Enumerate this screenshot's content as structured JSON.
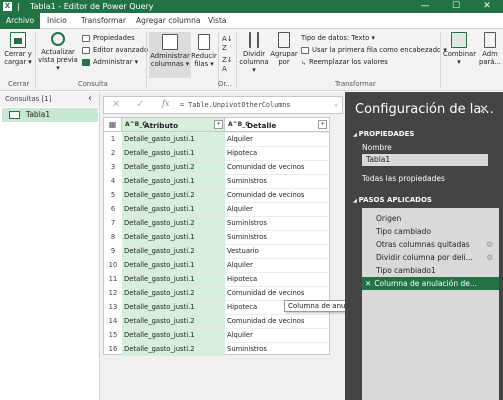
{
  "window": {
    "title": "Tabla1 - Editor de Power Query",
    "app_icon": "X",
    "controls": [
      "—",
      "☐",
      "✕"
    ]
  },
  "ribbon_tabs": [
    "Archivo",
    "Inicio",
    "Transformar",
    "Agregar columna",
    "Vista"
  ],
  "ribbon": {
    "cerrar": {
      "label": "Cerrar y cargar",
      "line1": "Cerrar y",
      "line2": "cargar ▾",
      "group": "Cerrar"
    },
    "consulta": {
      "actualizar_line1": "Actualizar",
      "actualizar_line2": "vista previa ▾",
      "propiedades": "Propiedades",
      "editor_avanzado": "Editor avanzado",
      "administrar": "Administrar ▾",
      "group": "Consulta"
    },
    "admin_cols": {
      "line1": "Administrar",
      "line2": "columnas ▾"
    },
    "reducir": {
      "line1": "Reducir",
      "line2": "filas ▾"
    },
    "ordenar_group": "Or...",
    "dividir": {
      "line1": "Dividir",
      "line2": "columna ▾"
    },
    "agrupar": {
      "line1": "Agrupar",
      "line2": "por"
    },
    "transformar": {
      "tipo_datos": "Tipo de datos: Texto ▾",
      "primera_fila": "Usar la primera fila como encabezado ▾",
      "reemplazar": "Reemplazar los valores",
      "group": "Transformar"
    },
    "combinar": "Combinar",
    "adm_param": {
      "line1": "Adm",
      "line2": "pará..."
    }
  },
  "queries": {
    "header": "Consultas [1]",
    "collapse": "‹",
    "items": [
      {
        "label": "Tabla1"
      }
    ]
  },
  "formula_bar": {
    "cancel": "✕",
    "commit": "✓",
    "fx": "fx",
    "text": "= Table.UnpivotOtherColumns",
    "expand": "⌄"
  },
  "grid": {
    "corner": "▦",
    "type_icon": "A^B_C",
    "columns": [
      {
        "name": "Atributo"
      },
      {
        "name": "Detalle"
      }
    ],
    "rows": [
      {
        "n": "1",
        "a": "Detalle_gasto_justi.1",
        "b": "Alquiler"
      },
      {
        "n": "2",
        "a": "Detalle_gasto_justi.1",
        "b": "Hipoteca"
      },
      {
        "n": "3",
        "a": "Detalle_gasto_justi.2",
        "b": "Comunidad de vecinos"
      },
      {
        "n": "4",
        "a": "Detalle_gasto_justi.1",
        "b": "Suministros"
      },
      {
        "n": "5",
        "a": "Detalle_gasto_justi.2",
        "b": "Comunidad de vecinos"
      },
      {
        "n": "6",
        "a": "Detalle_gasto_justi.1",
        "b": "Alquiler"
      },
      {
        "n": "7",
        "a": "Detalle_gasto_justi.2",
        "b": "Suministros"
      },
      {
        "n": "8",
        "a": "Detalle_gasto_justi.1",
        "b": "Suministros"
      },
      {
        "n": "9",
        "a": "Detalle_gasto_justi.2",
        "b": "Vestuario"
      },
      {
        "n": "10",
        "a": "Detalle_gasto_justi.1",
        "b": "Alquiler"
      },
      {
        "n": "11",
        "a": "Detalle_gasto_justi.1",
        "b": "Hipoteca"
      },
      {
        "n": "12",
        "a": "Detalle_gasto_justi.2",
        "b": "Comunidad de vecinos"
      },
      {
        "n": "13",
        "a": "Detalle_gasto_justi.1",
        "b": "Hipoteca"
      },
      {
        "n": "14",
        "a": "Detalle_gasto_justi.2",
        "b": "Comunidad de vecinos"
      },
      {
        "n": "15",
        "a": "Detalle_gasto_justi.1",
        "b": "Alquiler"
      },
      {
        "n": "16",
        "a": "Detalle_gasto_justi.2",
        "b": "Suministros"
      }
    ]
  },
  "tooltip": "Columna de anulación de dinamización",
  "settings": {
    "title": "Configuración de la...",
    "close": "✕",
    "propiedades_header": "PROPIEDADES",
    "nombre_label": "Nombre",
    "nombre_value": "Tabla1",
    "todas_props": "Todas las propiedades",
    "pasos_header": "PASOS APLICADOS",
    "steps": [
      {
        "label": "Origen",
        "gear": false,
        "selected": false
      },
      {
        "label": "Tipo cambiado",
        "gear": false,
        "selected": false
      },
      {
        "label": "Otras columnas quitadas",
        "gear": true,
        "selected": false
      },
      {
        "label": "Dividir columna por deli...",
        "gear": true,
        "selected": false
      },
      {
        "label": "Tipo cambiado1",
        "gear": false,
        "selected": false
      },
      {
        "label": "Columna de anulación de...",
        "gear": false,
        "selected": true
      }
    ],
    "delete_icon": "✕"
  },
  "colors": {
    "excel_green": "#217346",
    "selection_green": "#c6e7d2",
    "column_highlight": "#d6efdd",
    "settings_bg": "#444444"
  }
}
